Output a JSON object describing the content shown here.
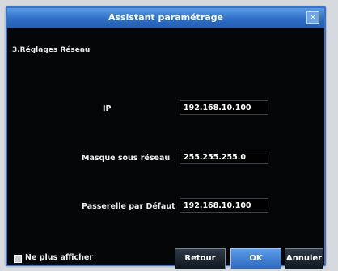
{
  "dialog": {
    "title": "Assistant paramétrage",
    "close_label": "×"
  },
  "section": {
    "title": "3.Réglages Réseau"
  },
  "fields": {
    "ip": {
      "label": "IP",
      "value": "192.168.10.100"
    },
    "subnet": {
      "label": "Masque sous réseau",
      "value": "255.255.255.0"
    },
    "gateway": {
      "label": "Passerelle par Défaut",
      "value": "192.168.10.100"
    }
  },
  "footer": {
    "checkbox_label": "Ne plus afficher",
    "back_label": "Retour",
    "ok_label": "OK",
    "cancel_label": "Annuler"
  },
  "colors": {
    "titlebar": "#2f6fc6",
    "window_bg": "#050608",
    "primary_button": "#2e68bf"
  }
}
